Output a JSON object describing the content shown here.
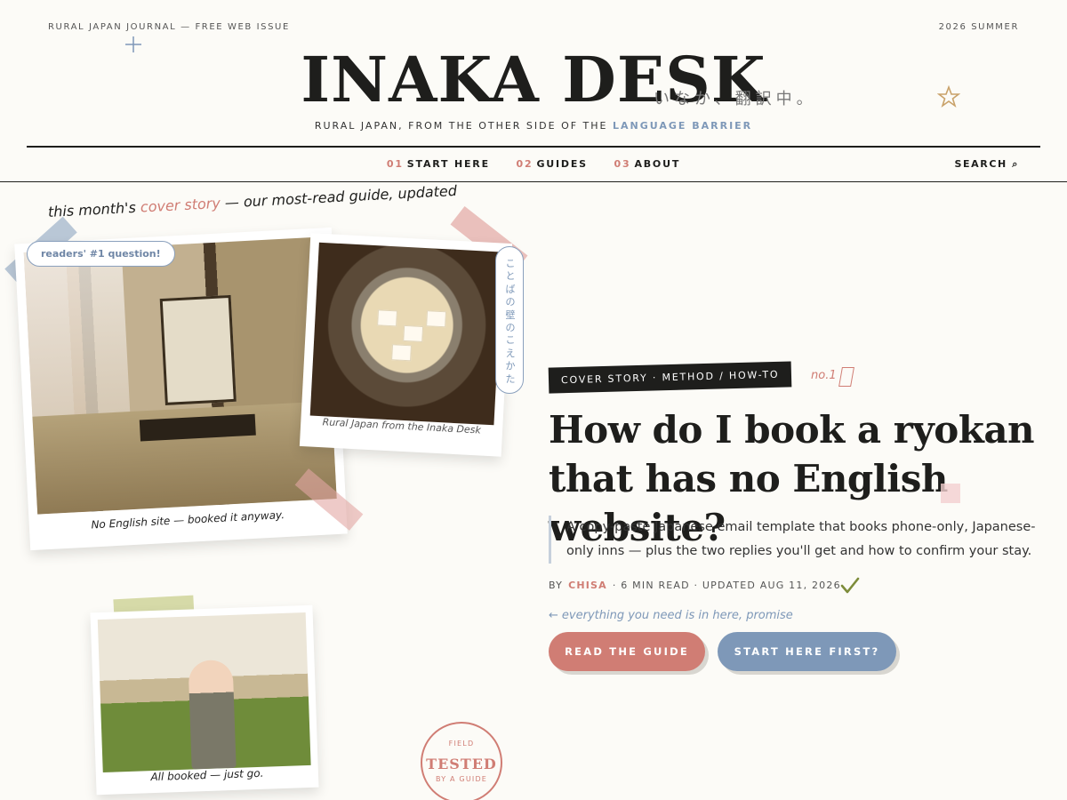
{
  "header": {
    "issue_label": "RURAL JAPAN JOURNAL — FREE WEB ISSUE",
    "season_label": "2026 SUMMER",
    "title": "INAKA DESK",
    "title_jp": "いなか、翻訳中。",
    "tagline_main": "RURAL JAPAN, FROM THE OTHER SIDE OF THE ",
    "tagline_accent": "LANGUAGE BARRIER"
  },
  "nav": {
    "items": [
      {
        "num": "01",
        "label": "START HERE"
      },
      {
        "num": "02",
        "label": "GUIDES"
      },
      {
        "num": "03",
        "label": "ABOUT"
      }
    ],
    "search_label": "SEARCH ⌕"
  },
  "hero": {
    "kicker_prefix": "this month's ",
    "kicker_accent": "cover story",
    "kicker_suffix": " — our most-read guide, updated",
    "callout": "readers' #1 question!",
    "vertical_label": "ことばの壁のこえかた",
    "captions": {
      "room": "No English site — booked it anyway.",
      "nabe": "Rural Japan from the Inaka Desk",
      "market": "All booked — just go."
    },
    "stamp": {
      "top": "FIELD",
      "main": "TESTED",
      "bottom": "BY A GUIDE"
    }
  },
  "article": {
    "tag": "COVER STORY · METHOD / HOW-TO",
    "rank": "no.1",
    "headline": "How do I book a ryokan that has no English website?",
    "dek": "A copy-paste Japanese email template that books phone-only, Japanese-only inns — plus the two replies you'll get and how to confirm your stay.",
    "byline_prefix": "BY",
    "author": "CHISA",
    "byline_meta": "· 6 MIN READ · UPDATED AUG 11, 2026",
    "hint": "everything you need is in here, promise",
    "primary_button": "READ THE GUIDE",
    "secondary_button": "START HERE FIRST?"
  },
  "colors": {
    "accent_red": "#d07d74",
    "accent_blue": "#7e98b8",
    "ink": "#1e1e1c",
    "paper": "#fcfbf7"
  }
}
